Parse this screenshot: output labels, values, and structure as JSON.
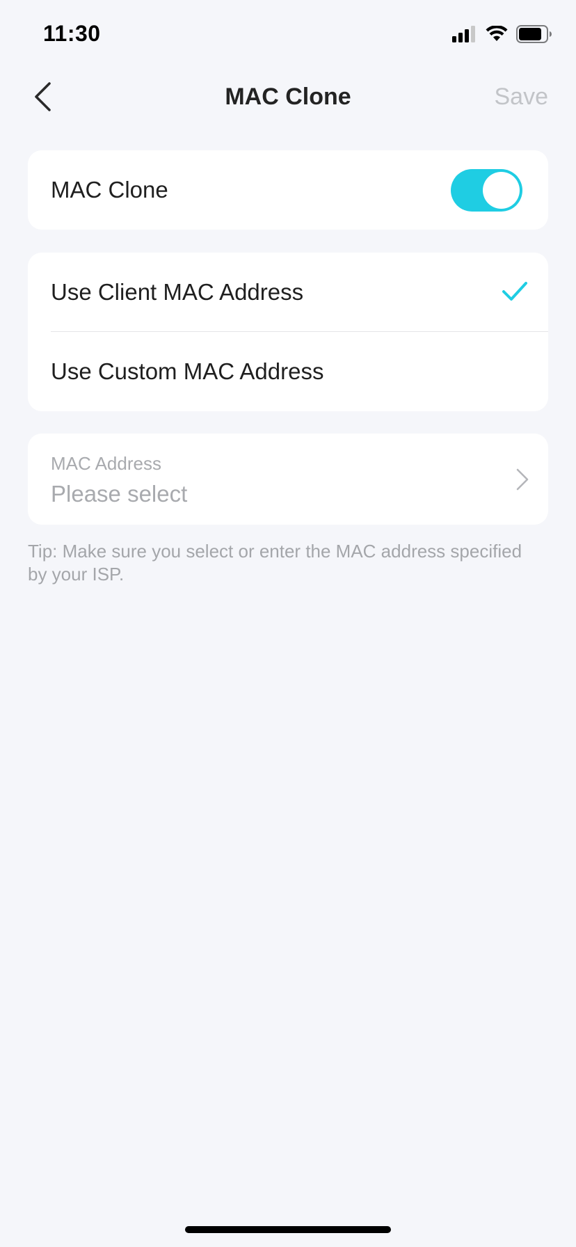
{
  "status_bar": {
    "time": "11:30",
    "icons": [
      "signal-icon",
      "wifi-icon",
      "battery-icon"
    ]
  },
  "nav": {
    "title": "MAC Clone",
    "save_label": "Save",
    "back_icon": "chevron-left-icon"
  },
  "mac_clone": {
    "label": "MAC Clone",
    "enabled": true
  },
  "options": [
    {
      "label": "Use Client MAC Address",
      "selected": true
    },
    {
      "label": "Use Custom MAC Address",
      "selected": false
    }
  ],
  "mac_address": {
    "label": "MAC Address",
    "placeholder": "Please select"
  },
  "tip": "Tip: Make sure you select or enter the MAC address specified by your ISP.",
  "colors": {
    "accent": "#1fcde3",
    "background": "#f5f6fa",
    "disabled_text": "#c2c4c8",
    "secondary_text": "#a8aaae"
  }
}
